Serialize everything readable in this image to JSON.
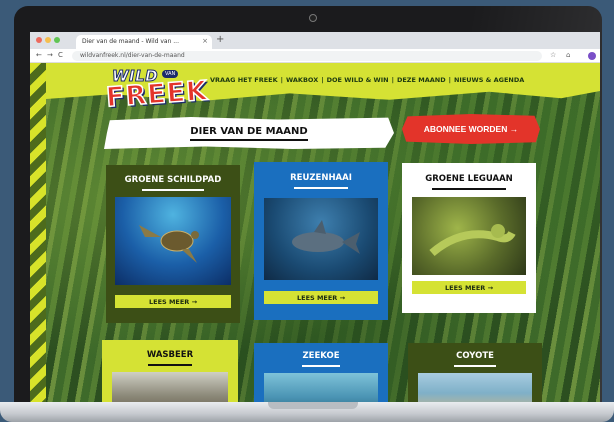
{
  "browser": {
    "tab_title": "Dier van de maand - Wild van ...",
    "tab_close": "×",
    "new_tab": "+",
    "url": "wildvanfreek.nl/dier-van-de-maand",
    "nav_back": "←",
    "nav_forward": "→",
    "nav_reload": "C",
    "home_icon": "⌂",
    "star_icon": "☆"
  },
  "site": {
    "logo_wild": "WILD",
    "logo_bubble": "VAN",
    "logo_freek": "FREEK",
    "nav": [
      {
        "label": "VRAAG HET FREEK"
      },
      {
        "label": "WAKBOX"
      },
      {
        "label": "DOE WILD & WIN"
      },
      {
        "label": "DEZE MAAND"
      },
      {
        "label": "NIEUWS & AGENDA"
      }
    ],
    "nav_separator": "|",
    "page_title": "DIER VAN DE MAAND",
    "subscribe_label": "ABONNEE WORDEN →",
    "cards": [
      {
        "title": "GROENE SCHILDPAD",
        "button": "LEES MEER →"
      },
      {
        "title": "REUZENHAAI",
        "button": "LEES MEER →"
      },
      {
        "title": "GROENE LEGUAAN",
        "button": "LEES MEER →"
      },
      {
        "title": "WASBEER"
      },
      {
        "title": "ZEEKOE"
      },
      {
        "title": "COYOTE"
      }
    ]
  },
  "colors": {
    "lime": "#d5e234",
    "red": "#e3342a",
    "blue": "#1a6fbf",
    "dark_green": "#3c4f16"
  }
}
